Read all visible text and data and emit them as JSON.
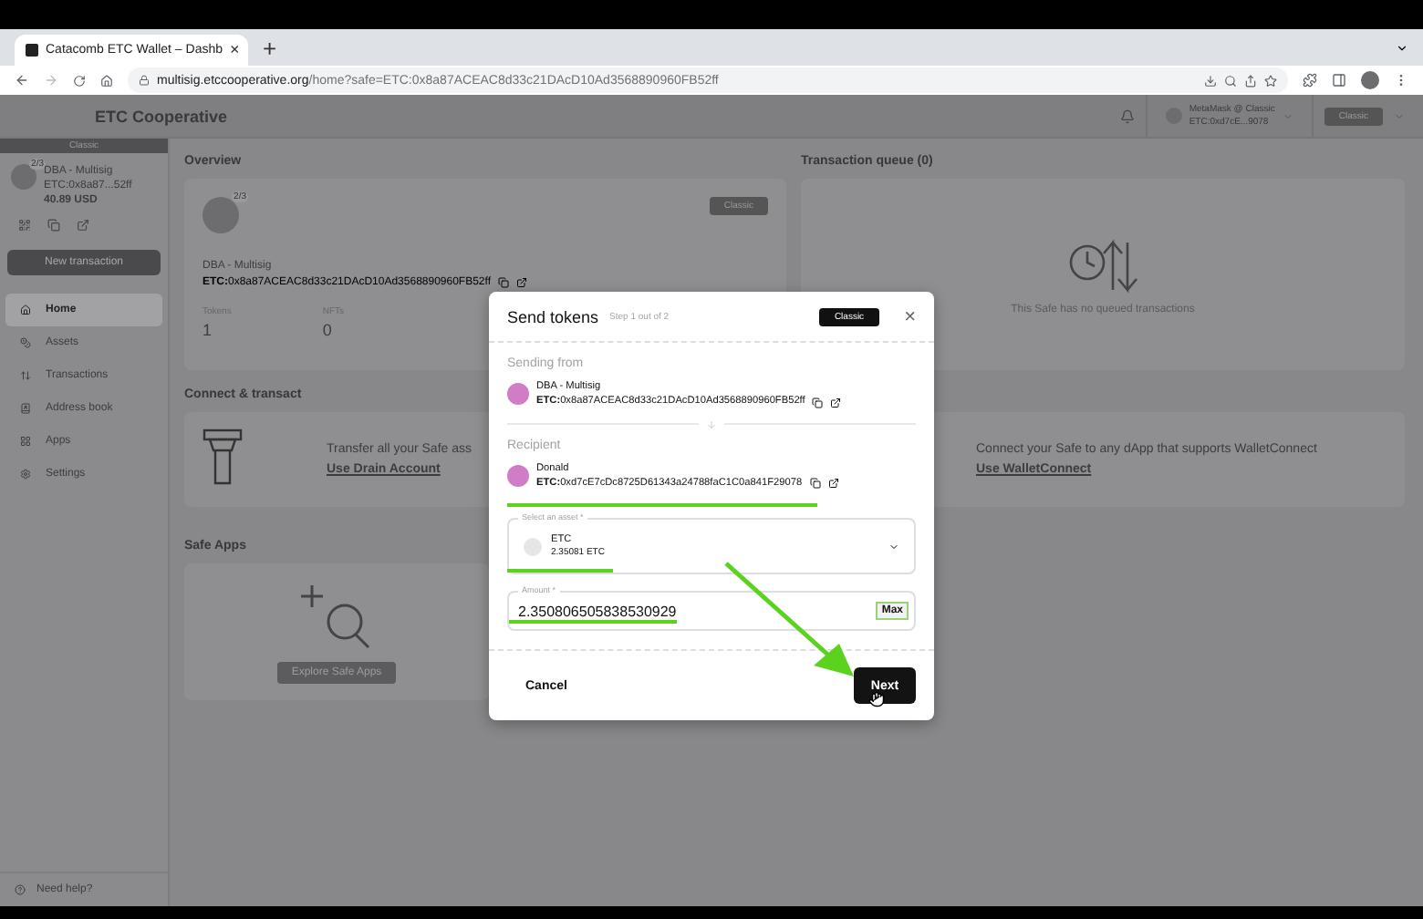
{
  "browser": {
    "tab": {
      "title": "Catacomb ETC Wallet – Dashb",
      "close": "×"
    },
    "new_tab": "+",
    "address": {
      "host": "multisig.etccooperative.org",
      "path": "/home?safe=ETC:0x8a87ACEAC8d33c21DAcD10Ad3568890960FB52ff"
    }
  },
  "header": {
    "brand": "ETC Cooperative",
    "wallet": {
      "name": "MetaMask @ Classic",
      "address": "ETC:0xd7cE...9078"
    },
    "network": "Classic"
  },
  "sidebar": {
    "network": "Classic",
    "safe": {
      "threshold": "2/3",
      "name": "DBA - Multisig",
      "address": "ETC:0x8a87...52ff",
      "balance": "40.89 USD"
    },
    "new_transaction": "New transaction",
    "items": [
      {
        "label": "Home",
        "selected": true
      },
      {
        "label": "Assets",
        "selected": false
      },
      {
        "label": "Transactions",
        "selected": false
      },
      {
        "label": "Address book",
        "selected": false
      },
      {
        "label": "Apps",
        "selected": false
      },
      {
        "label": "Settings",
        "selected": false
      }
    ],
    "help": "Need help?"
  },
  "overview": {
    "title": "Overview",
    "network": "Classic",
    "threshold": "2/3",
    "name": "DBA - Multisig",
    "prefix": "ETC:",
    "address": "0x8a87ACEAC8d33c21DAcD10Ad3568890960FB52ff",
    "stats": [
      {
        "label": "Tokens",
        "value": "1"
      },
      {
        "label": "NFTs",
        "value": "0"
      }
    ]
  },
  "queue": {
    "title": "Transaction queue (0)",
    "empty": "This Safe has no queued transactions"
  },
  "connect": {
    "title": "Connect & transact",
    "cards": [
      {
        "text": "Transfer all your Safe ass",
        "link": "Use Drain Account"
      },
      {
        "text": "Connect your Safe to any dApp that supports WalletConnect",
        "link": "Use WalletConnect"
      }
    ]
  },
  "safe_apps": {
    "title": "Safe Apps",
    "button": "Explore Safe Apps"
  },
  "modal": {
    "title": "Send tokens",
    "step": "Step 1 out of 2",
    "network": "Classic",
    "close": "×",
    "sending_from": {
      "label": "Sending from",
      "name": "DBA - Multisig",
      "prefix": "ETC:",
      "address": "0x8a87ACEAC8d33c21DAcD10Ad3568890960FB52ff"
    },
    "recipient": {
      "label": "Recipient",
      "name": "Donald",
      "prefix": "ETC:",
      "address": "0xd7cE7cDc8725D61343a24788faC1C0a841F29078"
    },
    "asset": {
      "label": "Select an asset *",
      "symbol": "ETC",
      "balance": "2.35081 ETC"
    },
    "amount": {
      "label": "Amount *",
      "value": "2.350806505838530929",
      "max": "Max"
    },
    "cancel": "Cancel",
    "next": "Next"
  }
}
